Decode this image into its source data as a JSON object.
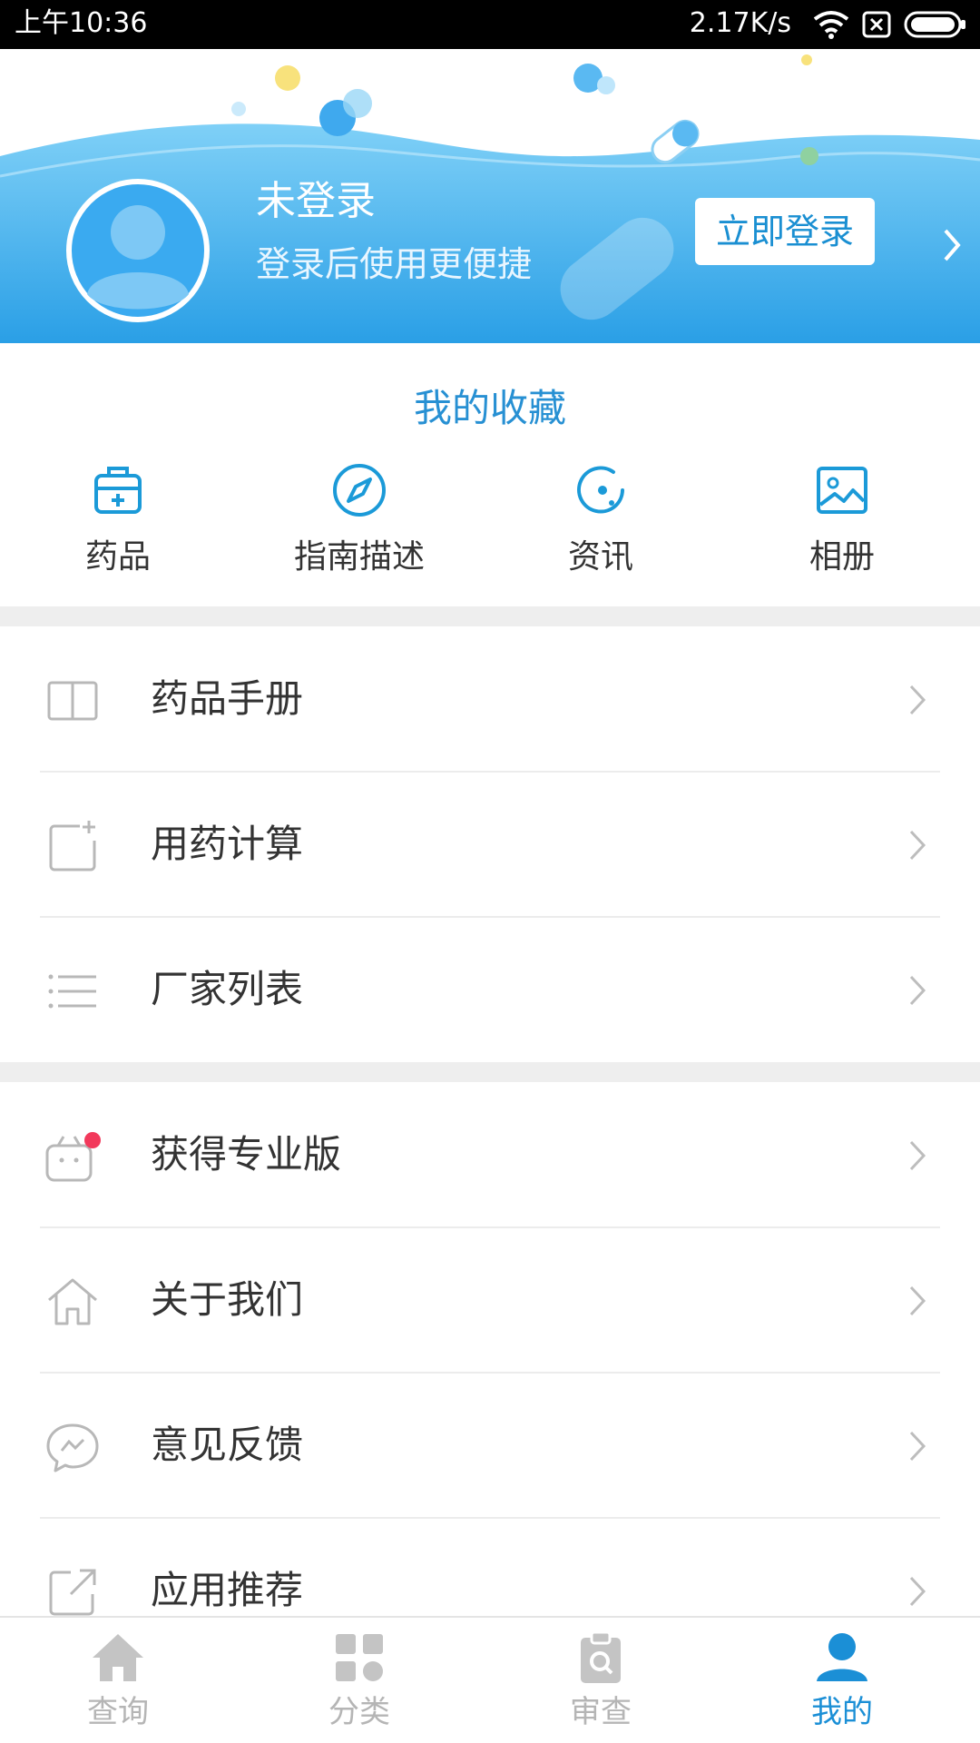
{
  "status_bar": {
    "time": "上午10:36",
    "speed": "2.17K/s",
    "icons": [
      "wifi-icon",
      "sim-blocked-icon",
      "battery-icon"
    ]
  },
  "header": {
    "title": "未登录",
    "subtitle": "登录后使用更便捷",
    "login_button": "立即登录",
    "gradient_colors": [
      "#7fd0f7",
      "#2a9fe6"
    ]
  },
  "favorites": {
    "title": "我的收藏",
    "items": [
      {
        "label": "药品",
        "icon": "medicine-box-icon"
      },
      {
        "label": "指南描述",
        "icon": "compass-icon"
      },
      {
        "label": "资讯",
        "icon": "news-icon"
      },
      {
        "label": "相册",
        "icon": "album-icon"
      }
    ]
  },
  "menu_group_1": [
    {
      "label": "药品手册",
      "icon": "book-icon"
    },
    {
      "label": "用药计算",
      "icon": "calculate-icon"
    },
    {
      "label": "厂家列表",
      "icon": "list-icon"
    }
  ],
  "menu_group_2": [
    {
      "label": "获得专业版",
      "icon": "bag-icon",
      "badge": true
    },
    {
      "label": "关于我们",
      "icon": "home-icon"
    },
    {
      "label": "意见反馈",
      "icon": "feedback-icon"
    },
    {
      "label": "应用推荐",
      "icon": "share-icon"
    }
  ],
  "bottom_nav": [
    {
      "label": "查询",
      "icon": "house-icon",
      "active": false
    },
    {
      "label": "分类",
      "icon": "grid-icon",
      "active": false
    },
    {
      "label": "审查",
      "icon": "clipboard-icon",
      "active": false
    },
    {
      "label": "我的",
      "icon": "user-icon",
      "active": true
    }
  ],
  "colors": {
    "accent": "#1b8fd6",
    "badge": "#f2395b",
    "inactive": "#b5b5b5"
  }
}
